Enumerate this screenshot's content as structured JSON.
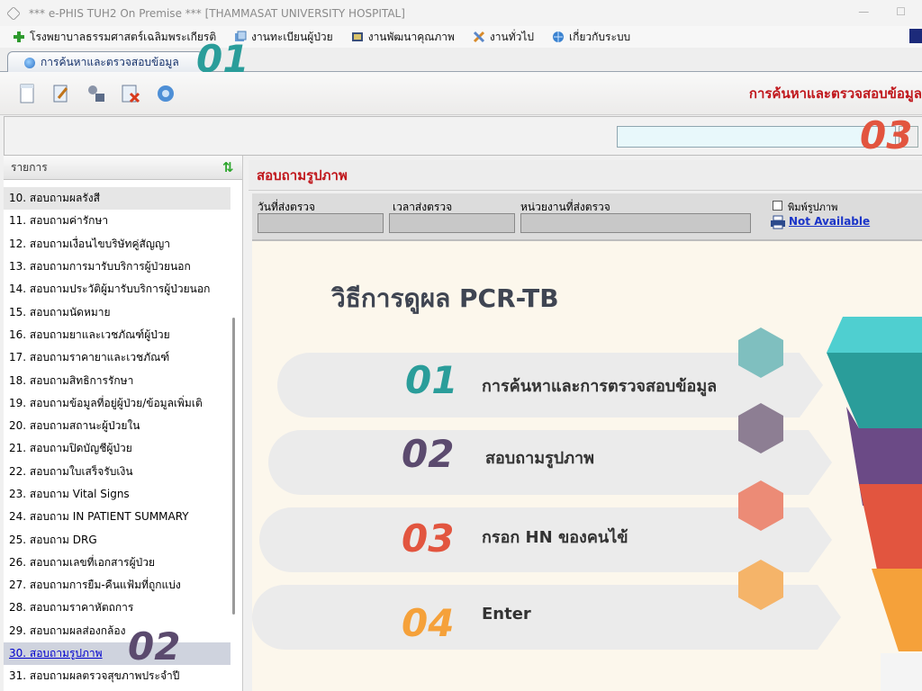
{
  "window": {
    "title": "*** e-PHIS TUH2 On Premise *** [THAMMASAT UNIVERSITY HOSPITAL]"
  },
  "menu": {
    "items": [
      {
        "label": "โรงพยาบาลธรรมศาสตร์เฉลิมพระเกียรติ",
        "icon": "green-plus-icon"
      },
      {
        "label": "งานทะเบียนผู้ป่วย",
        "icon": "register-icon"
      },
      {
        "label": "งานพัฒนาคุณภาพ",
        "icon": "quality-icon"
      },
      {
        "label": "งานทั่วไป",
        "icon": "tools-icon"
      },
      {
        "label": "เกี่ยวกับระบบ",
        "icon": "globe-icon"
      }
    ]
  },
  "tab": {
    "label": "การค้นหาและตรวจสอบข้อมูล"
  },
  "toolbar": {
    "heading": "การค้นหาและตรวจสอบข้อมูล"
  },
  "search": {
    "value": ""
  },
  "sidebar": {
    "header": "รายการ",
    "items": [
      {
        "label": "10.  สอบถามผลรังสี"
      },
      {
        "label": "11.  สอบถามค่ารักษา"
      },
      {
        "label": "12.  สอบถามเงื่อนไขบริษัทคู่สัญญา"
      },
      {
        "label": "13.  สอบถามการมารับบริการผู้ป่วยนอก"
      },
      {
        "label": "14.  สอบถามประวัติผู้มารับบริการผู้ป่วยนอก"
      },
      {
        "label": "15.  สอบถามนัดหมาย"
      },
      {
        "label": "16.  สอบถามยาและเวชภัณฑ์ผู้ป่วย"
      },
      {
        "label": "17.  สอบถามราคายาและเวชภัณฑ์"
      },
      {
        "label": "18.  สอบถามสิทธิการรักษา"
      },
      {
        "label": "19.  สอบถามข้อมูลที่อยู่ผู้ป่วย/ข้อมูลเพิ่มเติ"
      },
      {
        "label": "20.  สอบถามสถานะผู้ป่วยใน"
      },
      {
        "label": "21.  สอบถามปิดบัญชีผู้ป่วย"
      },
      {
        "label": "22.  สอบถามใบเสร็จรับเงิน"
      },
      {
        "label": "23.  สอบถาม Vital Signs"
      },
      {
        "label": "24.  สอบถาม IN PATIENT SUMMARY"
      },
      {
        "label": "25.  สอบถาม DRG"
      },
      {
        "label": "26.  สอบถามเลขที่เอกสารผู้ป่วย"
      },
      {
        "label": "27.  สอบถามการยืม-คืนแฟ้มที่ถูกแบ่ง"
      },
      {
        "label": "28.  สอบถามราคาหัตถการ"
      },
      {
        "label": "29.  สอบถามผลส่องกล้อง"
      },
      {
        "label": "30.  สอบถามรูปภาพ"
      },
      {
        "label": "31.  สอบถามผลตรวจสุขภาพประจำปี"
      }
    ]
  },
  "content": {
    "title": "สอบถามรูปภาพ",
    "fields": {
      "send_date": "วันที่ส่งตรวจ",
      "send_time": "เวลาส่งตรวจ",
      "send_unit": "หน่วยงานที่ส่งตรวจ"
    },
    "print_label": "พิมพ์รูปภาพ",
    "not_available": "Not Available"
  },
  "slide": {
    "title": "วิธีการดูผล PCR-TB",
    "steps": [
      {
        "num": "01",
        "text": "การค้นหาและการตรวจสอบข้อมูล",
        "color": "#2a9d9a"
      },
      {
        "num": "02",
        "text": "สอบถามรูปภาพ",
        "color": "#5b4a6e"
      },
      {
        "num": "03",
        "text": "กรอก HN ของคนไข้",
        "color": "#e2553f"
      },
      {
        "num": "04",
        "text": "Enter",
        "color": "#f5a13a"
      }
    ]
  },
  "overlays": {
    "tab_marker": "01",
    "sidebar_marker": "02",
    "search_marker": "03"
  }
}
